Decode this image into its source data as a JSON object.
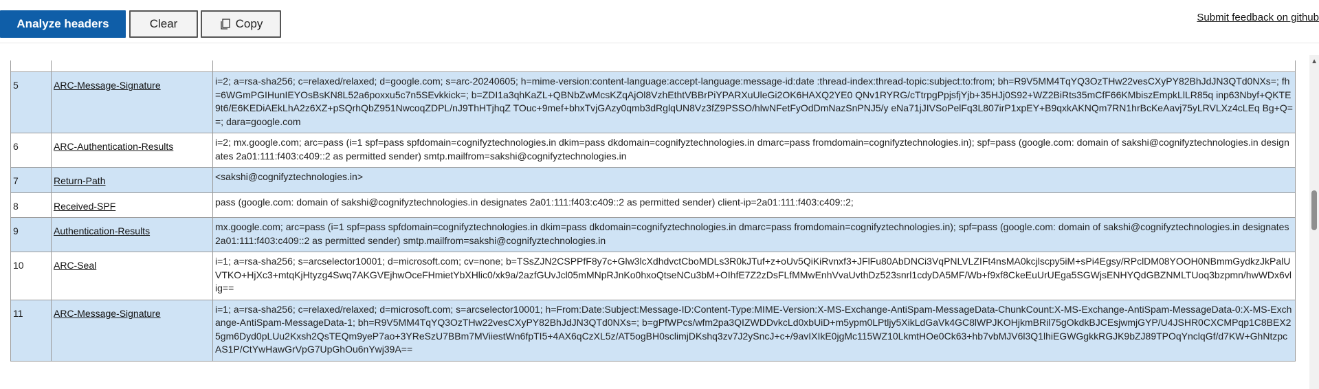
{
  "toolbar": {
    "analyze_label": "Analyze headers",
    "clear_label": "Clear",
    "copy_label": "Copy",
    "feedback_label": "Submit feedback on github"
  },
  "rows": [
    {
      "num": "",
      "name": "",
      "value": "",
      "highlight": false,
      "partial": true
    },
    {
      "num": "5",
      "name": "ARC-Message-Signature",
      "value": "i=2; a=rsa-sha256; c=relaxed/relaxed; d=google.com; s=arc-20240605; h=mime-version:content-language:accept-language:message-id:date :thread-index:thread-topic:subject:to:from; bh=R9V5MM4TqYQ3OzTHw22vesCXyPY82BhJdJN3QTd0NXs=; fh=6WGmPGIHunIEYOsBsKN8L52a6poxxu5c7n5SEvkkick=; b=ZDI1a3qhKaZL+QBNbZwMcsKZqAjOl8VzhEthtVBBrPiYPARXuUleGi2OK6HAXQ2YE0 QNv1RYRG/cTtrpgPpjsfjYjb+35HJj0S92+WZ2BiRts35mCfF66KMbiszEmpkLlLR85q inp63Nbyf+QKTE9t6/E6KEDiAEkLhA2z6XZ+pSQrhQbZ951NwcoqZDPL/nJ9ThHTjhqZ TOuc+9mef+bhxTvjGAzy0qmb3dRglqUN8Vz3fZ9PSSO/hlwNFetFyOdDmNazSnPNJ5/y eNa71jJIVSoPelFq3L807irP1xpEY+B9qxkAKNQm7RN1hrBcKeAavj75yLRVLXz4cLEq Bg+Q==; dara=google.com",
      "highlight": true
    },
    {
      "num": "6",
      "name": "ARC-Authentication-Results",
      "value": "i=2; mx.google.com; arc=pass (i=1 spf=pass spfdomain=cognifyztechnologies.in dkim=pass dkdomain=cognifyztechnologies.in dmarc=pass fromdomain=cognifyztechnologies.in); spf=pass (google.com: domain of sakshi@cognifyztechnologies.in designates 2a01:111:f403:c409::2 as permitted sender) smtp.mailfrom=sakshi@cognifyztechnologies.in",
      "highlight": false
    },
    {
      "num": "7",
      "name": "Return-Path",
      "value": "<sakshi@cognifyztechnologies.in>",
      "highlight": true
    },
    {
      "num": "8",
      "name": "Received-SPF",
      "value": "pass (google.com: domain of sakshi@cognifyztechnologies.in designates 2a01:111:f403:c409::2 as permitted sender) client-ip=2a01:111:f403:c409::2;",
      "highlight": false
    },
    {
      "num": "9",
      "name": "Authentication-Results",
      "value": "mx.google.com; arc=pass (i=1 spf=pass spfdomain=cognifyztechnologies.in dkim=pass dkdomain=cognifyztechnologies.in dmarc=pass fromdomain=cognifyztechnologies.in); spf=pass (google.com: domain of sakshi@cognifyztechnologies.in designates 2a01:111:f403:c409::2 as permitted sender) smtp.mailfrom=sakshi@cognifyztechnologies.in",
      "highlight": true
    },
    {
      "num": "10",
      "name": "ARC-Seal",
      "value": "i=1; a=rsa-sha256; s=arcselector10001; d=microsoft.com; cv=none; b=TSsZJN2CSPPfF8y7c+Glw3lcXdhdvctCboMDLs3R0kJTuf+z+oUv5QiKiRvnxf3+JFlFu80AbDNCi3VqPNLVLZIFt4nsMA0kcjlscpy5iM+sPi4Egsy/RPclDM08YOOH0NBmmGydkzJkPalUVTKO+HjXc3+mtqKjHtyzg4Swq7AKGVEjhwOceFHmietYbXHlic0/xk9a/2azfGUvJcl05mMNpRJnKo0hxoQtseNCu3bM+OIhfE7Z2zDsFLfMMwEnhVvaUvthDz523snrl1cdyDA5MF/Wb+f9xf8CkeEuUrUEga5SGWjsENHYQdGBZNMLTUoq3bzpmn/hwWDx6vlig==",
      "highlight": false
    },
    {
      "num": "11",
      "name": "ARC-Message-Signature",
      "value": "i=1; a=rsa-sha256; c=relaxed/relaxed; d=microsoft.com; s=arcselector10001; h=From:Date:Subject:Message-ID:Content-Type:MIME-Version:X-MS-Exchange-AntiSpam-MessageData-ChunkCount:X-MS-Exchange-AntiSpam-MessageData-0:X-MS-Exchange-AntiSpam-MessageData-1; bh=R9V5MM4TqYQ3OzTHw22vesCXyPY82BhJdJN3QTd0NXs=; b=gPfWPcs/wfm2pa3QIZWDDvkcLd0xbUiD+m5ypm0LPtljy5XikLdGaVk4GC8lWPJKOHjkmBRil75gOkdkBJCEsjwmjGYP/U4JSHR0CXCMPqp1C8BEX25gm6Dyd0pLUu2Kxsh2QsTEQm9yeP7ao+3YReSzU7BBm7MViiestWn6fpTI5+4AX6qCzXL5z/AT5ogBH0sclimjDKshq3zv7J2ySncJ+c+/9avIXIkE0jgMc115WZ10LkmtHOe0Ck63+hb7vbMJV6l3Q1lhiEGWGgkkRGJK9bZJ89TPOqYnclqGf/d7KW+GhNtzpcAS1P/CtYwHawGrVpG7UpGhOu6nYwj39A==",
      "highlight": true
    }
  ]
}
